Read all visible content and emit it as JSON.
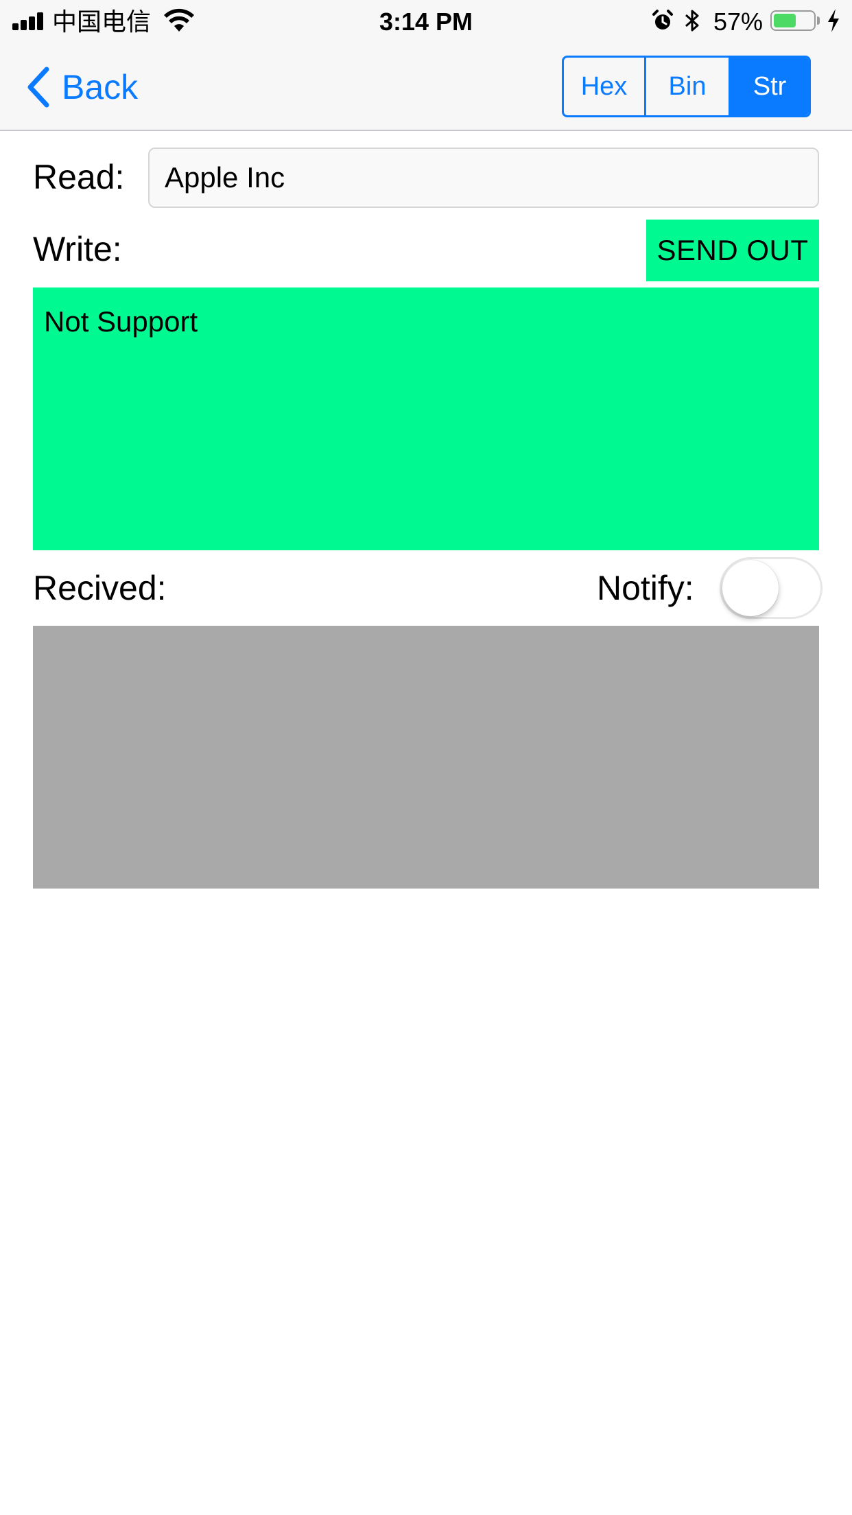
{
  "status_bar": {
    "carrier": "中国电信",
    "time": "3:14 PM",
    "battery_percent": "57%",
    "battery_level": 0.57,
    "icons": [
      "signal-icon",
      "wifi-icon",
      "alarm-icon",
      "bluetooth-icon",
      "battery-icon",
      "charging-bolt-icon"
    ]
  },
  "nav": {
    "back_label": "Back",
    "segments": [
      {
        "label": "Hex",
        "active": false
      },
      {
        "label": "Bin",
        "active": false
      },
      {
        "label": "Str",
        "active": true
      }
    ]
  },
  "read": {
    "label": "Read:",
    "value": "Apple Inc"
  },
  "write": {
    "label": "Write:",
    "send_label": "SEND OUT",
    "text": "Not Support"
  },
  "received": {
    "label": "Recived:",
    "notify_label": "Notify:",
    "notify_on": false,
    "text": ""
  },
  "colors": {
    "accent": "#0a7aff",
    "write_bg": "#00fa91",
    "received_bg": "#a9a9a9",
    "battery_green": "#4cd964"
  }
}
